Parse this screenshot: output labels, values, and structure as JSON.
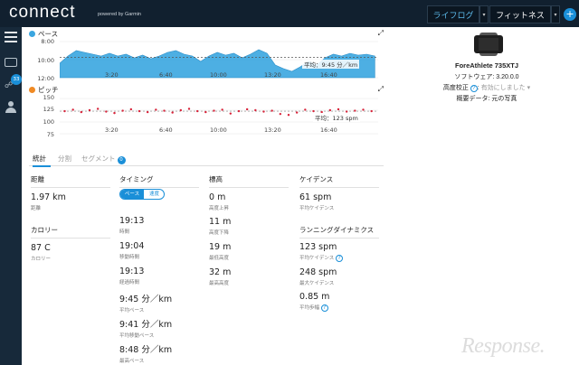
{
  "header": {
    "logo": "connect",
    "powered": "powered by Garmin",
    "tab_lifelog": "ライフログ",
    "tab_fitness": "フィットネス",
    "plus": "+"
  },
  "sidebar": {
    "badge": "33"
  },
  "pace_chart": {
    "label": "ペース",
    "color": "#3aa6e0",
    "yticks": [
      "8:00",
      "10:00",
      "12:00"
    ],
    "xticks": [
      "3:20",
      "6:40",
      "10:00",
      "13:20",
      "16:40"
    ],
    "avg_label": "平均：9:45 分／km"
  },
  "cadence_chart": {
    "label": "ピッチ",
    "color": "#f08a24",
    "dot_color": "#d8233a",
    "yticks": [
      "150",
      "125",
      "100",
      "75"
    ],
    "xticks": [
      "3:20",
      "6:40",
      "10:00",
      "13:20",
      "16:40"
    ],
    "avg_label": "平均：123 spm"
  },
  "chart_data": [
    {
      "type": "area",
      "title": "ペース",
      "x": [
        0,
        0.5,
        1,
        1.5,
        2,
        2.5,
        3,
        3.5,
        4,
        4.5,
        5,
        5.5,
        6,
        6.5,
        7,
        7.5,
        8,
        8.5,
        9,
        9.5,
        10,
        10.5,
        11,
        11.5,
        12,
        12.5,
        13,
        13.5,
        14,
        14.5,
        15,
        15.5,
        16,
        16.5,
        17,
        17.5,
        18,
        18.5,
        19
      ],
      "y": [
        10.4,
        9.6,
        9.0,
        9.2,
        9.4,
        9.6,
        9.3,
        9.6,
        9.4,
        9.8,
        9.5,
        9.9,
        9.6,
        9.2,
        9.0,
        9.4,
        9.6,
        10.2,
        9.6,
        9.2,
        9.5,
        9.3,
        9.8,
        9.4,
        8.9,
        9.3,
        10.6,
        11.0,
        11.3,
        10.8,
        10.2,
        10.6,
        9.8,
        9.4,
        9.6,
        9.3,
        9.5,
        9.4,
        9.6
      ],
      "xlim": [
        0,
        19.2
      ],
      "ylim": [
        8,
        12
      ],
      "y_inverted": true,
      "avg": 9.75,
      "xticks": [
        "3:20",
        "6:40",
        "10:00",
        "13:20",
        "16:40"
      ]
    },
    {
      "type": "scatter",
      "title": "ピッチ",
      "x": [
        0.3,
        0.8,
        1.3,
        1.8,
        2.3,
        2.8,
        3.3,
        3.8,
        4.3,
        4.8,
        5.3,
        5.8,
        6.3,
        6.8,
        7.3,
        7.8,
        8.3,
        8.8,
        9.3,
        9.8,
        10.3,
        10.8,
        11.3,
        11.8,
        12.3,
        12.8,
        13.3,
        13.8,
        14.3,
        14.8,
        15.3,
        15.8,
        16.3,
        16.8,
        17.3,
        17.8,
        18.3,
        18.8
      ],
      "y": [
        123,
        126,
        121,
        125,
        128,
        122,
        119,
        124,
        127,
        123,
        121,
        126,
        124,
        120,
        125,
        128,
        123,
        121,
        124,
        126,
        118,
        123,
        127,
        125,
        122,
        124,
        117,
        115,
        120,
        126,
        123,
        121,
        125,
        127,
        122,
        124,
        126,
        123
      ],
      "xlim": [
        0,
        19.2
      ],
      "ylim": [
        75,
        150
      ],
      "avg": 123,
      "xticks": [
        "3:20",
        "6:40",
        "10:00",
        "13:20",
        "16:40"
      ]
    }
  ],
  "device": {
    "name": "ForeAthlete 735XTJ",
    "software": "ソフトウェア: 3.20.0.0",
    "cal_label": "高度校正",
    "cal_value": "有効にしました",
    "data_label": "概要データ: 元の写真"
  },
  "tabs": {
    "stats": "統計",
    "split": "分割",
    "segment": "セグメント",
    "segment_count": "0"
  },
  "stats": {
    "distance_head": "距離",
    "distance_val": "1.97 km",
    "distance_lab": "距離",
    "calories_head": "カロリー",
    "calories_val": "87 C",
    "calories_lab": "カロリー",
    "timing_head": "タイミング",
    "toggle_pace": "ペース",
    "toggle_speed": "速度",
    "time_val": "19:13",
    "time_lab": "時間",
    "moving_val": "19:04",
    "moving_lab": "移動時間",
    "elapsed_val": "19:13",
    "elapsed_lab": "経過時間",
    "avgpace_val": "9:45 分／km",
    "avgpace_lab": "平均ペース",
    "movpace_val": "9:41 分／km",
    "movpace_lab": "平均移動ペース",
    "bestpace_val": "8:48 分／km",
    "bestpace_lab": "最高ペース",
    "elev_head": "標高",
    "gain_val": "0 m",
    "gain_lab": "高度上昇",
    "loss_val": "11 m",
    "loss_lab": "高度下降",
    "minel_val": "19 m",
    "minel_lab": "最低高度",
    "maxel_val": "32 m",
    "maxel_lab": "最高高度",
    "cad_head": "ケイデンス",
    "avgcad_val": "61 spm",
    "avgcad_lab": "平均ケイデンス",
    "dyn_head": "ランニングダイナミクス",
    "avgpitch_val": "123 spm",
    "avgpitch_lab": "平均ケイデンス",
    "maxpitch_val": "248 spm",
    "maxpitch_lab": "最大ケイデンス",
    "stride_val": "0.85 m",
    "stride_lab": "平均歩幅"
  },
  "watermark": "Response."
}
